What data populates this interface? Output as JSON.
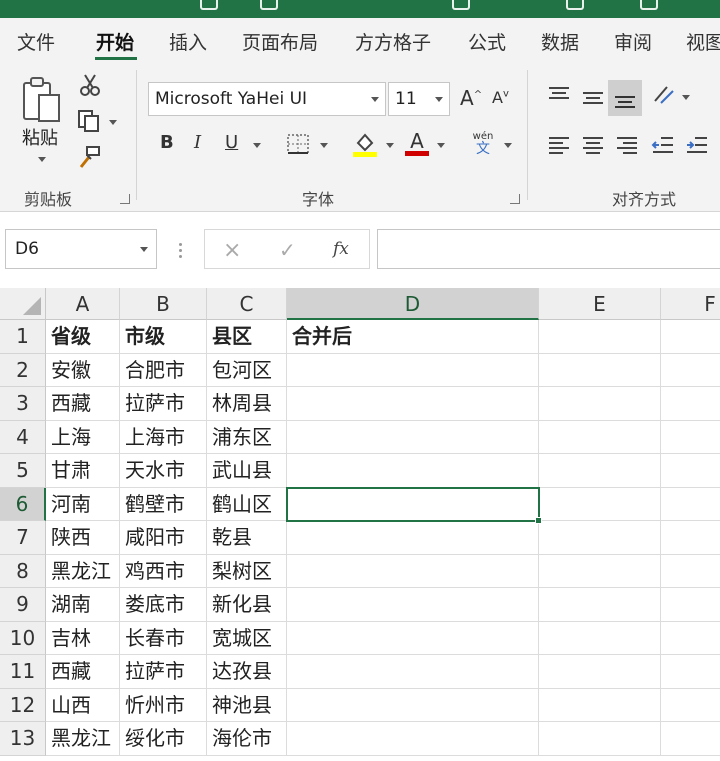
{
  "ribbon": {
    "tabs": [
      "文件",
      "开始",
      "插入",
      "页面布局",
      "方方格子",
      "公式",
      "数据",
      "审阅",
      "视图"
    ],
    "active_tab": "开始",
    "clipboard": {
      "paste_label": "粘贴",
      "group_label": "剪贴板"
    },
    "font": {
      "family": "Microsoft YaHei UI",
      "size": "11",
      "bold": "B",
      "italic": "I",
      "underline": "U",
      "grow": "A",
      "shrink": "A",
      "font_color_glyph": "A",
      "phonetic_top": "wén",
      "phonetic_bottom": "文",
      "group_label": "字体",
      "highlight_color": "#ffff00",
      "font_color": "#d00000"
    },
    "alignment": {
      "group_label": "对齐方式"
    }
  },
  "formula_bar": {
    "name_box": "D6",
    "fx_label": "fx",
    "value": ""
  },
  "sheet": {
    "columns": [
      "A",
      "B",
      "C",
      "D",
      "E",
      "F"
    ],
    "selected_column": "D",
    "selected_row": "6",
    "rows": [
      {
        "num": "1",
        "cells": [
          "省级",
          "市级",
          "县区",
          "合并后"
        ],
        "bold": true
      },
      {
        "num": "2",
        "cells": [
          "安徽",
          "合肥市",
          "包河区",
          ""
        ]
      },
      {
        "num": "3",
        "cells": [
          "西藏",
          "拉萨市",
          "林周县",
          ""
        ]
      },
      {
        "num": "4",
        "cells": [
          "上海",
          "上海市",
          "浦东区",
          ""
        ]
      },
      {
        "num": "5",
        "cells": [
          "甘肃",
          "天水市",
          "武山县",
          ""
        ]
      },
      {
        "num": "6",
        "cells": [
          "河南",
          "鹤壁市",
          "鹤山区",
          ""
        ]
      },
      {
        "num": "7",
        "cells": [
          "陕西",
          "咸阳市",
          "乾县",
          ""
        ]
      },
      {
        "num": "8",
        "cells": [
          "黑龙江",
          "鸡西市",
          "梨树区",
          ""
        ]
      },
      {
        "num": "9",
        "cells": [
          "湖南",
          "娄底市",
          "新化县",
          ""
        ]
      },
      {
        "num": "10",
        "cells": [
          "吉林",
          "长春市",
          "宽城区",
          ""
        ]
      },
      {
        "num": "11",
        "cells": [
          "西藏",
          "拉萨市",
          "达孜县",
          ""
        ]
      },
      {
        "num": "12",
        "cells": [
          "山西",
          "忻州市",
          "神池县",
          ""
        ]
      },
      {
        "num": "13",
        "cells": [
          "黑龙江",
          "绥化市",
          "海伦市",
          ""
        ]
      }
    ],
    "accent_color": "#217346"
  }
}
